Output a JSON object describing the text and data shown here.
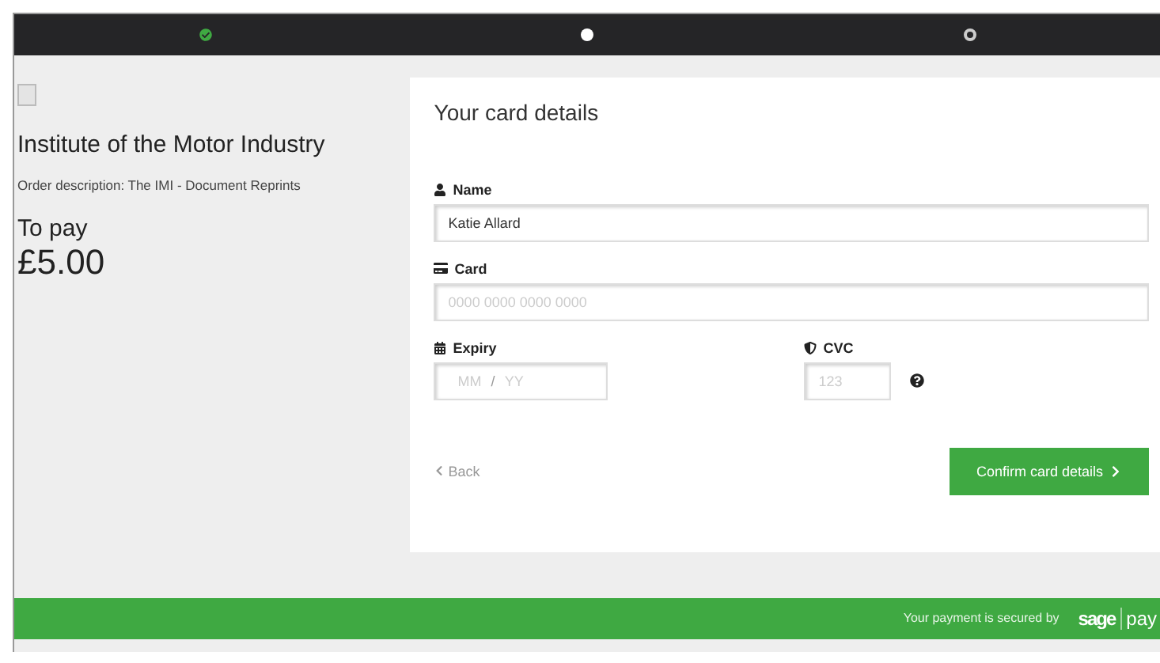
{
  "steps": [
    {
      "done": true,
      "selected": false
    },
    {
      "done": false,
      "selected": true
    },
    {
      "done": false,
      "selected": false
    }
  ],
  "merchant": {
    "name": "Institute of the Motor Industry",
    "description": "Order description: The IMI - Document Reprints",
    "to_pay_label": "To pay",
    "amount": "£5.00"
  },
  "form": {
    "title": "Your card details",
    "name": {
      "label": "Name",
      "value": "Katie Allard"
    },
    "card": {
      "label": "Card",
      "placeholder": "0000 0000 0000 0000"
    },
    "expiry": {
      "label": "Expiry",
      "month_placeholder": "MM",
      "separator": "/",
      "year_placeholder": "YY"
    },
    "cvc": {
      "label": "CVC",
      "placeholder": "123"
    },
    "back": "Back",
    "confirm": "Confirm card details"
  },
  "footer": {
    "text": "Your payment is secured by",
    "logo_left": "sage",
    "logo_right": "pay"
  }
}
